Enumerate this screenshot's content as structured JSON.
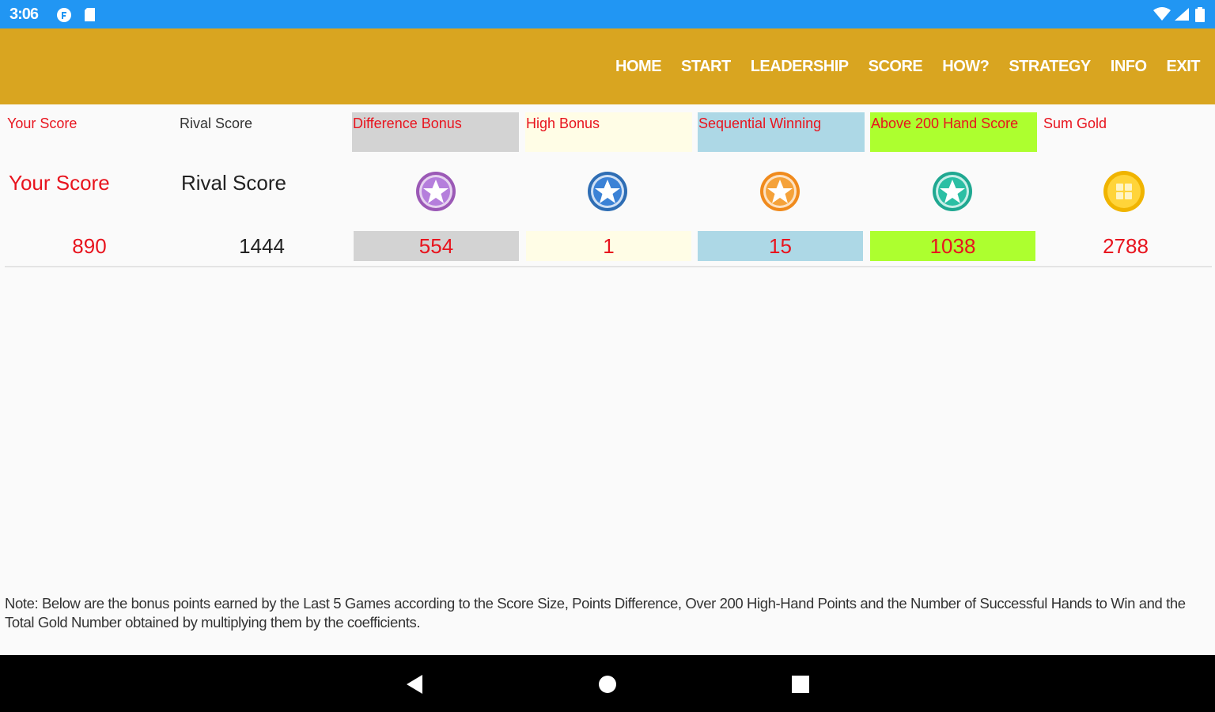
{
  "status_bar": {
    "time": "3:06",
    "left_icons": [
      "notification-icon",
      "sd-card-icon"
    ],
    "right_icons": [
      "wifi-icon",
      "signal-icon",
      "battery-icon"
    ]
  },
  "app_bar": {
    "color": "#d9a520",
    "nav": [
      {
        "id": "home",
        "label": "HOME"
      },
      {
        "id": "start",
        "label": "START"
      },
      {
        "id": "leadership",
        "label": "LEADERSHIP"
      },
      {
        "id": "score",
        "label": "SCORE"
      },
      {
        "id": "how",
        "label": "HOW?"
      },
      {
        "id": "strategy",
        "label": "STRATEGY"
      },
      {
        "id": "info",
        "label": "INFO"
      },
      {
        "id": "exit",
        "label": "EXIT"
      }
    ]
  },
  "score_table": {
    "headers": {
      "your_score": "Your Score",
      "rival_score": "Rival Score",
      "difference_bonus": "Difference Bonus",
      "high_bonus": "High Bonus",
      "sequential_winning": "Sequential Winning",
      "above_200": "Above 200 Hand Score",
      "sum_gold": "Sum Gold"
    },
    "labels": {
      "your_score": "Your Score",
      "rival_score": "Rival Score"
    },
    "icons": {
      "difference_bonus": "purple-star-badge-icon",
      "high_bonus": "blue-star-badge-icon",
      "sequential_winning": "orange-star-badge-icon",
      "above_200": "teal-star-badge-icon",
      "sum_gold": "gold-coin-icon"
    },
    "values": {
      "your_score": "890",
      "rival_score": "1444",
      "difference_bonus": "554",
      "high_bonus": "1",
      "sequential_winning": "15",
      "above_200": "1038",
      "sum_gold": "2788"
    },
    "colors": {
      "difference_bonus": "#d3d3d3",
      "high_bonus": "#fffde6",
      "sequential_winning": "#add8e6",
      "above_200": "#adff2f",
      "text_red": "#e8141e"
    }
  },
  "note": "Note: Below are the bonus points earned by the Last 5 Games according to the Score Size, Points Difference, Over 200 High-Hand Points and the Number of Successful Hands to Win and the Total Gold Number obtained by multiplying them by the coefficients.",
  "nav_bar": {
    "buttons": [
      "back-icon",
      "home-icon",
      "recents-icon"
    ]
  }
}
